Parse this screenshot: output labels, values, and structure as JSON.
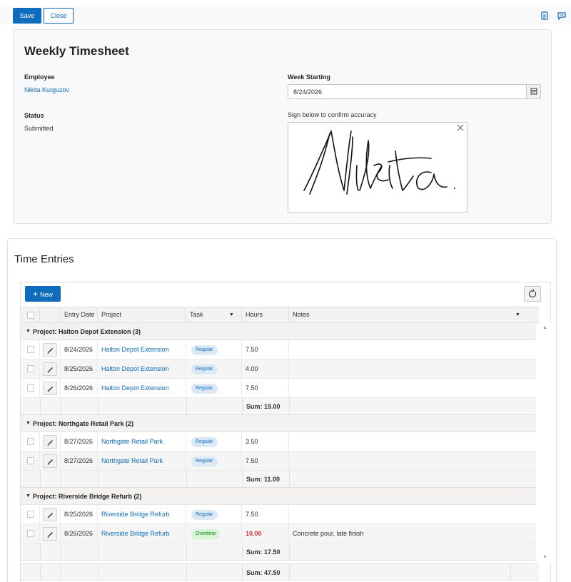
{
  "toolbar": {
    "save_label": "Save",
    "close_label": "Close",
    "icons": [
      "document-icon",
      "comment-icon"
    ]
  },
  "header": {
    "title": "Weekly Timesheet",
    "employee_label": "Employee",
    "employee_value": "Nikita Kurguzov",
    "week_label": "Week Starting",
    "week_value": "8/24/2026",
    "status_label": "Status",
    "status_value": "Submitted",
    "signature_hint": "Sign below to confirm accuracy",
    "signature_text": "Nikita"
  },
  "entries": {
    "title": "Time Entries",
    "new_label": "New",
    "columns": [
      "Entry Date",
      "Project",
      "Task",
      "Hours",
      "Notes"
    ],
    "groups": [
      {
        "label": "Project: Halton Depot Extension (3)",
        "rows": [
          {
            "date": "8/24/2026",
            "project": "Halton Depot Extension",
            "task": "Regular",
            "hours": "7.50",
            "notes": ""
          },
          {
            "date": "8/25/2026",
            "project": "Halton Depot Extension",
            "task": "Regular",
            "hours": "4.00",
            "notes": ""
          },
          {
            "date": "8/26/2026",
            "project": "Halton Depot Extension",
            "task": "Regular",
            "hours": "7.50",
            "notes": ""
          }
        ],
        "sum": "Sum: 19.00"
      },
      {
        "label": "Project: Northgate Retail Park (2)",
        "rows": [
          {
            "date": "8/27/2026",
            "project": "Northgate Retail Park",
            "task": "Regular",
            "hours": "3.50",
            "notes": ""
          },
          {
            "date": "8/27/2026",
            "project": "Northgate Retail Park",
            "task": "Regular",
            "hours": "7.50",
            "notes": ""
          }
        ],
        "sum": "Sum: 11.00"
      },
      {
        "label": "Project: Riverside Bridge Refurb (2)",
        "rows": [
          {
            "date": "8/25/2026",
            "project": "Riverside Bridge Refurb",
            "task": "Regular",
            "hours": "7.50",
            "notes": ""
          },
          {
            "date": "8/26/2026",
            "project": "Riverside Bridge Refurb",
            "task": "Overtime",
            "hours": "10.00",
            "notes": "Concrete pour, late finish"
          }
        ],
        "sum": "Sum: 17.50"
      }
    ],
    "total": "Sum: 47.50"
  },
  "colors": {
    "accent": "#0f6cbd",
    "regular_badge_bg": "#dbe9f7",
    "regular_badge_text": "#0f6cbd",
    "overtime_badge_bg": "#d6f5d6",
    "overtime_badge_text": "#107c10",
    "overtime_hours": "#d13438"
  }
}
